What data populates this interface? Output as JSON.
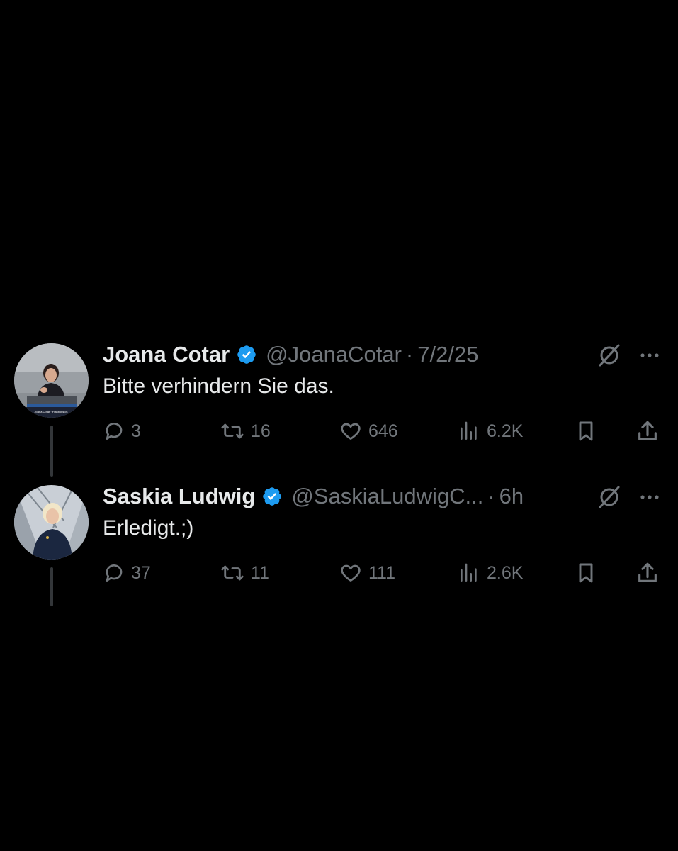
{
  "tweets": [
    {
      "name": "Joana Cotar",
      "handle": "@JoanaCotar",
      "separator": "·",
      "time": "7/2/25",
      "text": "Bitte verhindern Sie das.",
      "avatar_caption": "Joana Cotar · Fraktionslos",
      "stats": {
        "replies": "3",
        "reposts": "16",
        "likes": "646",
        "views": "6.2K"
      }
    },
    {
      "name": "Saskia Ludwig",
      "handle": "@SaskiaLudwigC...",
      "separator": "·",
      "time": "6h",
      "text": "Erledigt.;)",
      "stats": {
        "replies": "37",
        "reposts": "11",
        "likes": "111",
        "views": "2.6K"
      }
    }
  ],
  "colors": {
    "background": "#000000",
    "primary_text": "#e7e9ea",
    "secondary_text": "#71767b",
    "verified_badge": "#1d9bf0",
    "thread_line": "#333639"
  },
  "icons": [
    "verified-badge-icon",
    "grok-icon",
    "more-icon",
    "reply-icon",
    "repost-icon",
    "like-icon",
    "views-icon",
    "bookmark-icon",
    "share-icon"
  ]
}
